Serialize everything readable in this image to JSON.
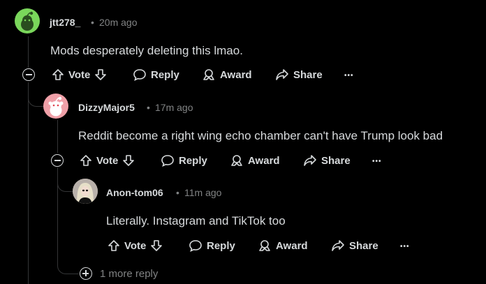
{
  "comments": [
    {
      "username": "jtt278_",
      "time": "20m ago",
      "text": "Mods desperately deleting this lmao.",
      "avatar_color": "#7ad65b"
    },
    {
      "username": "DizzyMajor5",
      "time": "17m ago",
      "text": "Reddit become a right wing echo chamber can't have Trump look bad",
      "avatar_color": "#f0a0a8"
    },
    {
      "username": "Anon-tom06",
      "time": "11m ago",
      "text": "Literally. Instagram and TikTok too",
      "avatar_color": "#c9c3bf"
    }
  ],
  "actions": {
    "vote": "Vote",
    "reply": "Reply",
    "award": "Award",
    "share": "Share",
    "more": "•••"
  },
  "more_replies": "1 more reply",
  "separator": "•"
}
